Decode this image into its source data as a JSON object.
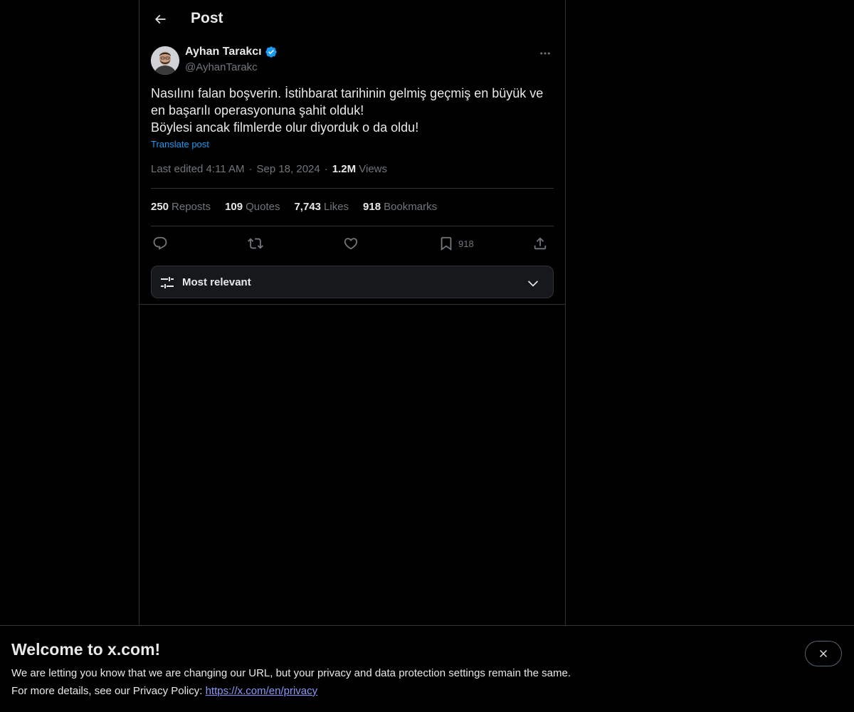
{
  "header": {
    "title": "Post",
    "back_icon": "arrow-left-icon"
  },
  "post": {
    "author": {
      "display_name": "Ayhan Tarakcı",
      "handle": "@AyhanTarakc",
      "verified": true,
      "verified_color": "#1d9bf0"
    },
    "text": "Nasılını falan boşverin. İstihbarat tarihinin gelmiş geçmiş en büyük ve en başarılı operasyonuna şahit olduk!\nBöylesi ancak filmlerde olur diyorduk o da oldu!",
    "translate_label": "Translate post",
    "meta": {
      "edited_time": "Last edited 4:11 AM",
      "separator": "·",
      "date": "Sep 18, 2024",
      "views_count": "1.2M",
      "views_label": "Views"
    },
    "stats": [
      {
        "count": "250",
        "label": "Reposts"
      },
      {
        "count": "109",
        "label": "Quotes"
      },
      {
        "count": "7,743",
        "label": "Likes"
      },
      {
        "count": "918",
        "label": "Bookmarks"
      }
    ],
    "actions": {
      "reply_icon": "reply-icon",
      "repost_icon": "repost-icon",
      "like_icon": "heart-icon",
      "bookmark_icon": "bookmark-icon",
      "bookmark_count": "918",
      "share_icon": "share-icon"
    }
  },
  "sort": {
    "label": "Most relevant"
  },
  "banner": {
    "title": "Welcome to x.com!",
    "line1": "We are letting you know that we are changing our URL, but your privacy and data protection settings remain the same.",
    "line2_prefix": "For more details, see our Privacy Policy: ",
    "link_text": "https://x.com/en/privacy"
  },
  "colors": {
    "background": "#000000",
    "text_primary": "#e7e9ea",
    "text_secondary": "#71767b",
    "accent": "#1d9bf0",
    "border": "#2f3336",
    "link": "#8b98f9"
  }
}
